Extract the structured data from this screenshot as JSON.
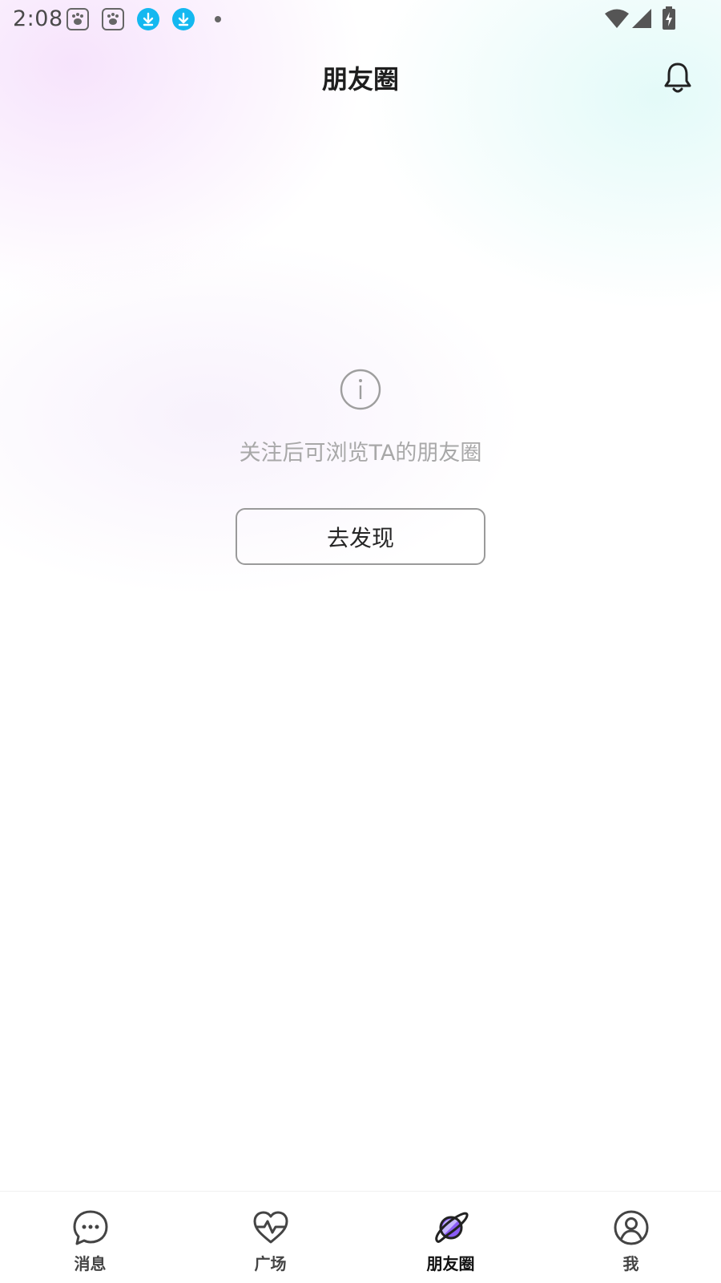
{
  "status_bar": {
    "time": "2:08",
    "icons": [
      "baidu-paw-icon",
      "baidu-paw-icon",
      "download-icon",
      "download-icon",
      "notification-dot-icon",
      "wifi-icon",
      "signal-icon",
      "battery-charging-icon"
    ],
    "download_color": "#14b8f0"
  },
  "header": {
    "title": "朋友圈",
    "bell_icon": "bell-icon"
  },
  "empty_state": {
    "icon": "info-icon",
    "message": "关注后可浏览TA的朋友圈",
    "button_label": "去发现"
  },
  "bottom_nav": {
    "items": [
      {
        "label": "消息",
        "icon": "chat-bubble-icon",
        "active": false
      },
      {
        "label": "广场",
        "icon": "heartbeat-icon",
        "active": false
      },
      {
        "label": "朋友圈",
        "icon": "planet-icon",
        "active": true
      },
      {
        "label": "我",
        "icon": "profile-icon",
        "active": false
      }
    ],
    "accent_color": "#8b5cf6"
  }
}
